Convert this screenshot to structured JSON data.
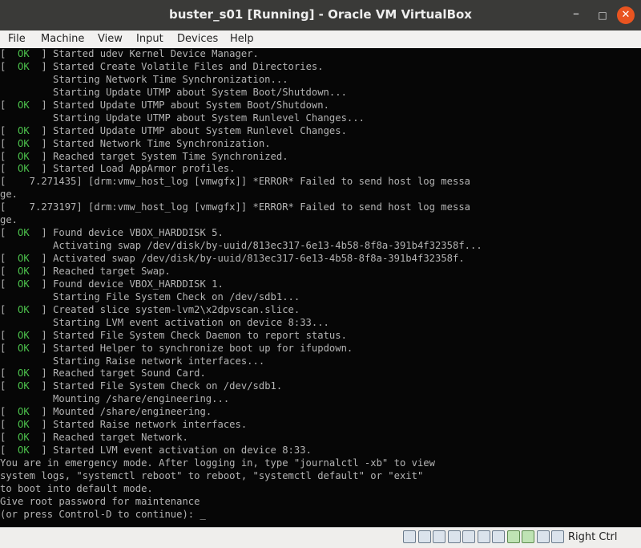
{
  "window": {
    "title": "buster_s01 [Running] - Oracle VM VirtualBox",
    "controls": {
      "minimize": "–",
      "maximize": "□",
      "close": "✕"
    }
  },
  "menu": [
    "File",
    "Machine",
    "View",
    "Input",
    "Devices",
    "Help"
  ],
  "console": {
    "lines": [
      {
        "ok": true,
        "text": "Started udev Kernel Device Manager."
      },
      {
        "ok": true,
        "text": "Started Create Volatile Files and Directories."
      },
      {
        "ok": false,
        "text": "         Starting Network Time Synchronization..."
      },
      {
        "ok": false,
        "text": "         Starting Update UTMP about System Boot/Shutdown..."
      },
      {
        "ok": true,
        "text": "Started Update UTMP about System Boot/Shutdown."
      },
      {
        "ok": false,
        "text": "         Starting Update UTMP about System Runlevel Changes..."
      },
      {
        "ok": true,
        "text": "Started Update UTMP about System Runlevel Changes."
      },
      {
        "ok": true,
        "text": "Started Network Time Synchronization."
      },
      {
        "ok": true,
        "text": "Reached target System Time Synchronized."
      },
      {
        "ok": true,
        "text": "Started Load AppArmor profiles."
      },
      {
        "ok": false,
        "text": "[    7.271435] [drm:vmw_host_log [vmwgfx]] *ERROR* Failed to send host log messa"
      },
      {
        "ok": false,
        "text": "ge."
      },
      {
        "ok": false,
        "text": "[    7.273197] [drm:vmw_host_log [vmwgfx]] *ERROR* Failed to send host log messa"
      },
      {
        "ok": false,
        "text": "ge."
      },
      {
        "ok": true,
        "text": "Found device VBOX_HARDDISK 5."
      },
      {
        "ok": false,
        "text": "         Activating swap /dev/disk/by-uuid/813ec317-6e13-4b58-8f8a-391b4f32358f..."
      },
      {
        "ok": true,
        "text": "Activated swap /dev/disk/by-uuid/813ec317-6e13-4b58-8f8a-391b4f32358f."
      },
      {
        "ok": true,
        "text": "Reached target Swap."
      },
      {
        "ok": true,
        "text": "Found device VBOX_HARDDISK 1."
      },
      {
        "ok": false,
        "text": "         Starting File System Check on /dev/sdb1..."
      },
      {
        "ok": true,
        "text": "Created slice system-lvm2\\x2dpvscan.slice."
      },
      {
        "ok": false,
        "text": "         Starting LVM event activation on device 8:33..."
      },
      {
        "ok": true,
        "text": "Started File System Check Daemon to report status."
      },
      {
        "ok": true,
        "text": "Started Helper to synchronize boot up for ifupdown."
      },
      {
        "ok": false,
        "text": "         Starting Raise network interfaces..."
      },
      {
        "ok": true,
        "text": "Reached target Sound Card."
      },
      {
        "ok": true,
        "text": "Started File System Check on /dev/sdb1."
      },
      {
        "ok": false,
        "text": "         Mounting /share/engineering..."
      },
      {
        "ok": true,
        "text": "Mounted /share/engineering."
      },
      {
        "ok": true,
        "text": "Started Raise network interfaces."
      },
      {
        "ok": true,
        "text": "Reached target Network."
      },
      {
        "ok": true,
        "text": "Started LVM event activation on device 8:33."
      },
      {
        "ok": false,
        "text": "You are in emergency mode. After logging in, type \"journalctl -xb\" to view"
      },
      {
        "ok": false,
        "text": "system logs, \"systemctl reboot\" to reboot, \"systemctl default\" or \"exit\""
      },
      {
        "ok": false,
        "text": "to boot into default mode."
      },
      {
        "ok": false,
        "text": "Give root password for maintenance"
      },
      {
        "ok": false,
        "text": "(or press Control-D to continue): "
      }
    ],
    "ok_tag": "  OK  ",
    "cursor": "_"
  },
  "statusbar": {
    "icons": [
      "hard-disk-icon",
      "optical-drive-icon",
      "audio-icon",
      "network-icon",
      "usb-icon",
      "shared-folders-icon",
      "display-icon",
      "video-capture-icon",
      "cpu-icon",
      "mouse-integration-icon",
      "keyboard-icon"
    ],
    "host_key": "Right Ctrl"
  }
}
